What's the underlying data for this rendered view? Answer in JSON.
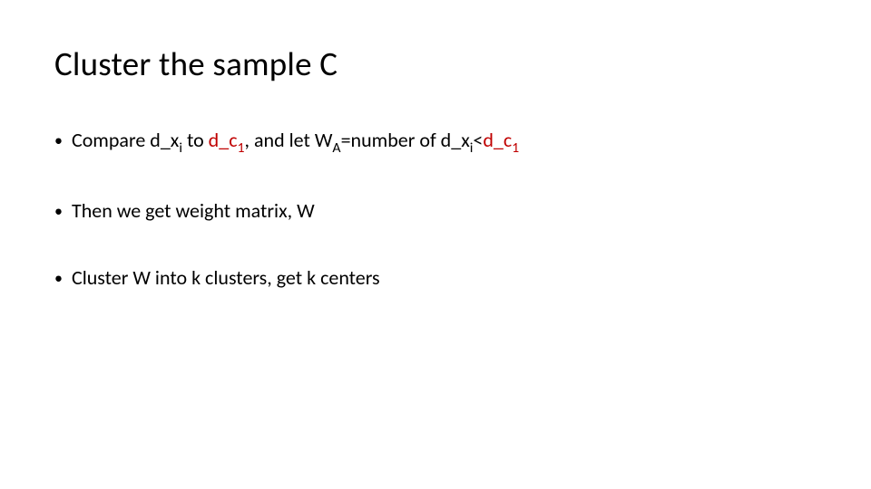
{
  "title": "Cluster the sample C",
  "bullet_marker": "•",
  "bullet1": {
    "p1": "Compare d_x",
    "sub_i1": "i",
    "p2": " to ",
    "red1_a": "d_c",
    "red1_sub": "1",
    "p3": ", and let W",
    "sub_A": "A",
    "p4": "=number of d_x",
    "sub_i2": "i",
    "p5": "<",
    "red2_a": "d_c",
    "red2_sub": "1"
  },
  "bullet2": "Then we get weight matrix, W",
  "bullet3": "Cluster W into k clusters, get k centers"
}
